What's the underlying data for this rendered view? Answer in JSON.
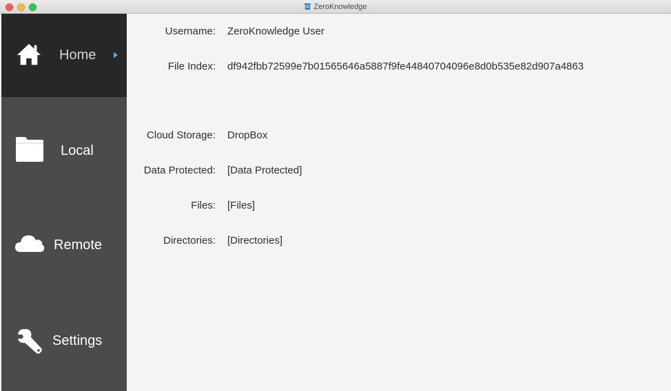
{
  "window": {
    "title": "ZeroKnowledge"
  },
  "sidebar": {
    "items": [
      {
        "label": "Home",
        "icon": "home-icon",
        "active": true
      },
      {
        "label": "Local",
        "icon": "folder-icon",
        "active": false
      },
      {
        "label": "Remote",
        "icon": "cloud-icon",
        "active": false
      },
      {
        "label": "Settings",
        "icon": "wrench-icon",
        "active": false
      }
    ]
  },
  "main": {
    "username_label": "Username:",
    "username_value": "ZeroKnowledge User",
    "file_index_label": "File Index:",
    "file_index_value": "df942fbb72599e7b01565646a5887f9fe44840704096e8d0b535e82d907a4863",
    "cloud_storage_label": "Cloud Storage:",
    "cloud_storage_value": "DropBox",
    "data_protected_label": "Data Protected:",
    "data_protected_value": "[Data Protected]",
    "files_label": "Files:",
    "files_value": "[Files]",
    "directories_label": "Directories:",
    "directories_value": "[Directories]"
  },
  "colors": {
    "sidebar_bg": "#4b4b4b",
    "sidebar_active_bg": "#272727",
    "accent": "#5ab4e6",
    "content_bg": "#f4f4f4"
  }
}
